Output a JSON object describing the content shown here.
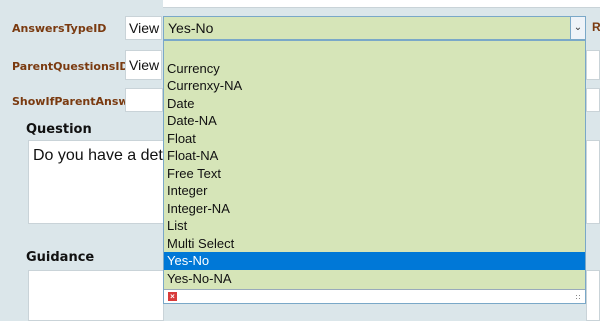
{
  "fields": {
    "answers_type_label": "AnswersTypeID",
    "parent_questions_label": "ParentQuestionsID",
    "show_if_parent_answer_label": "ShowIfParentAnswer",
    "view_label": "View",
    "right_cutoff_letter": "R"
  },
  "select": {
    "current_value": "Yes-No",
    "options": [
      "",
      "Currency",
      "Currenxy-NA",
      "Date",
      "Date-NA",
      "Float",
      "Float-NA",
      "Free Text",
      "Integer",
      "Integer-NA",
      "List",
      "Multi Select",
      "Yes-No",
      "Yes-No-NA"
    ],
    "selected_index": 12
  },
  "question": {
    "title": "Question",
    "value": "Do you have a deta"
  },
  "guidance": {
    "title": "Guidance",
    "value": ""
  },
  "colors": {
    "label": "#7a3a10",
    "select_bg": "#d6e5b8",
    "selected_bg": "#0078d7",
    "page_bg": "#dbe6ea"
  }
}
